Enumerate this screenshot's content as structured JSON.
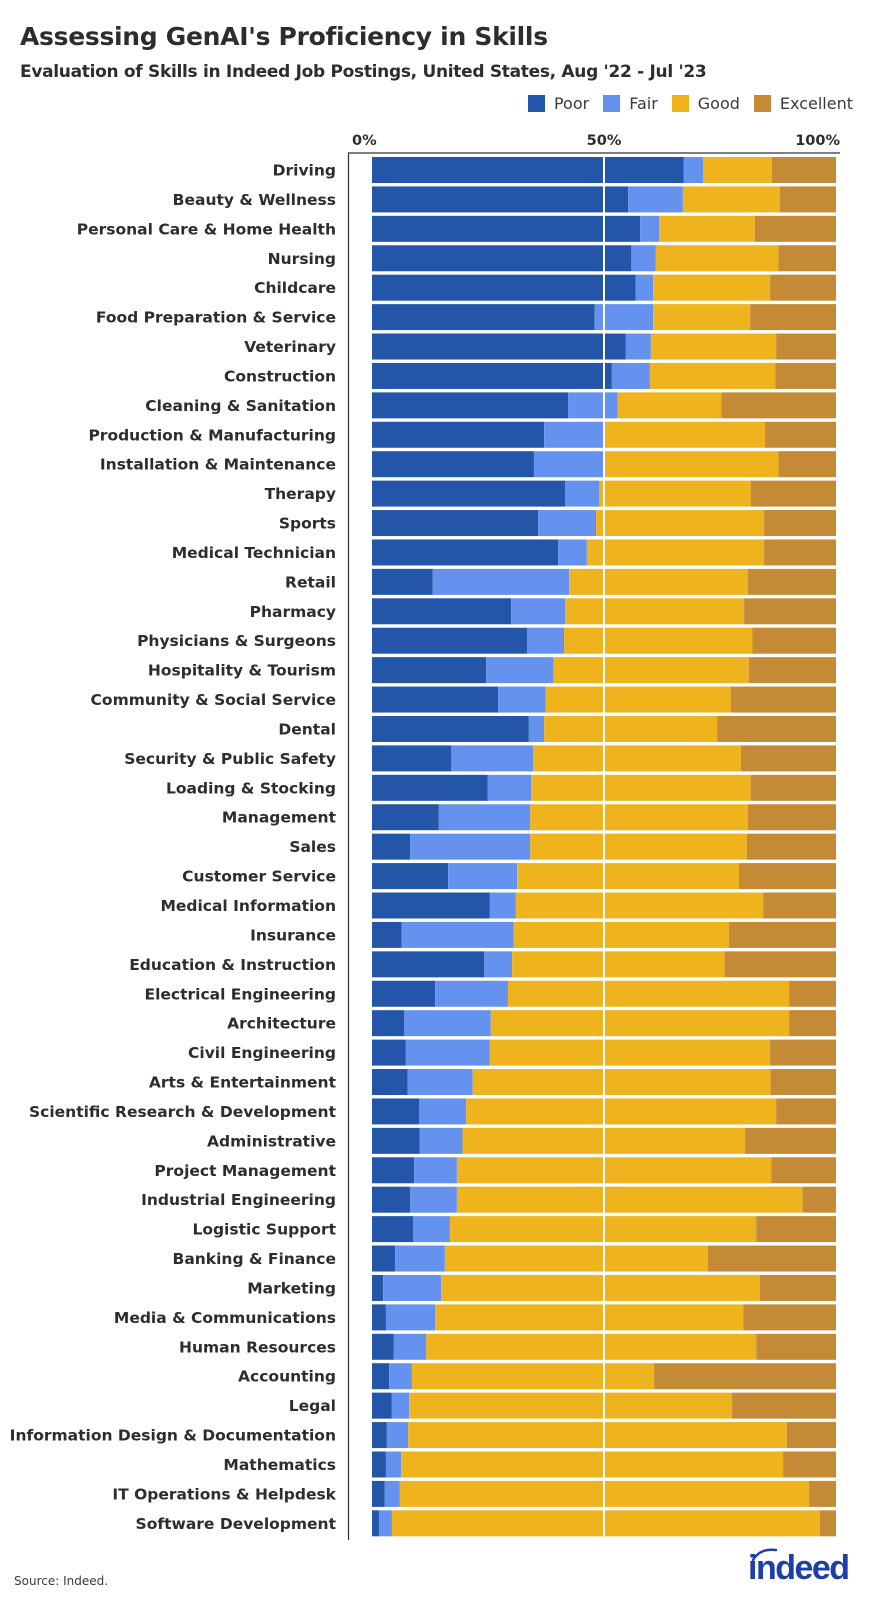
{
  "header": {
    "title": "Assessing GenAI's Proficiency in Skills",
    "subtitle": "Evaluation of Skills in Indeed Job Postings, United States, Aug '22 - Jul '23"
  },
  "footer": {
    "source": "Source: Indeed.",
    "logo_text": "indeed"
  },
  "chart_data": {
    "type": "bar",
    "orientation": "horizontal",
    "stacked": true,
    "normalized": true,
    "title": "Assessing GenAI's Proficiency in Skills",
    "subtitle": "Evaluation of Skills in Indeed Job Postings, United States, Aug '22 - Jul '23",
    "xlabel": "",
    "ylabel": "",
    "xlim": [
      0,
      100
    ],
    "x_ticks": [
      "0%",
      "50%",
      "100%"
    ],
    "x_tick_values": [
      0,
      50,
      100
    ],
    "reference_line": 50,
    "legend_position": "top-right",
    "grid": false,
    "categories": [
      "Driving",
      "Beauty & Wellness",
      "Personal Care & Home Health",
      "Nursing",
      "Childcare",
      "Food Preparation & Service",
      "Veterinary",
      "Construction",
      "Cleaning & Sanitation",
      "Production & Manufacturing",
      "Installation & Maintenance",
      "Therapy",
      "Sports",
      "Medical Technician",
      "Retail",
      "Pharmacy",
      "Physicians & Surgeons",
      "Hospitality & Tourism",
      "Community & Social Service",
      "Dental",
      "Security & Public Safety",
      "Loading & Stocking",
      "Management",
      "Sales",
      "Customer Service",
      "Medical Information",
      "Insurance",
      "Education & Instruction",
      "Electrical Engineering",
      "Architecture",
      "Civil Engineering",
      "Arts & Entertainment",
      "Scientific Research & Development",
      "Administrative",
      "Project Management",
      "Industrial Engineering",
      "Logistic Support",
      "Banking & Finance",
      "Marketing",
      "Media & Communications",
      "Human Resources",
      "Accounting",
      "Legal",
      "Information Design & Documentation",
      "Mathematics",
      "IT Operations & Helpdesk",
      "Software Development"
    ],
    "series": [
      {
        "name": "Poor",
        "color": "#2356a8",
        "values": [
          67.2,
          55.2,
          57.8,
          55.9,
          56.8,
          48.0,
          54.7,
          51.7,
          42.3,
          37.1,
          34.9,
          41.6,
          35.8,
          40.1,
          13.1,
          30.0,
          33.4,
          24.6,
          27.2,
          33.8,
          17.1,
          24.9,
          14.4,
          8.2,
          16.4,
          25.4,
          6.4,
          24.2,
          13.6,
          6.9,
          7.3,
          7.7,
          10.2,
          10.3,
          9.1,
          8.2,
          8.9,
          5.0,
          2.4,
          3.0,
          4.7,
          3.7,
          4.2,
          3.2,
          3.0,
          2.7,
          1.5
        ]
      },
      {
        "name": "Fair",
        "color": "#6592ee",
        "values": [
          4.2,
          11.8,
          4.1,
          5.2,
          3.8,
          12.6,
          5.4,
          8.2,
          10.6,
          12.8,
          15.0,
          7.4,
          12.5,
          6.2,
          29.4,
          11.6,
          8.0,
          14.5,
          10.2,
          3.3,
          17.6,
          9.4,
          19.7,
          25.9,
          14.9,
          5.6,
          24.1,
          6.0,
          15.7,
          18.7,
          18.1,
          14.0,
          10.1,
          9.2,
          9.2,
          10.1,
          7.9,
          10.7,
          12.5,
          10.6,
          7.0,
          4.9,
          3.8,
          4.6,
          3.3,
          3.3,
          2.8
        ]
      },
      {
        "name": "Good",
        "color": "#efb31d",
        "values": [
          14.8,
          20.9,
          20.6,
          26.5,
          25.2,
          20.9,
          27.0,
          27.0,
          22.4,
          34.8,
          37.7,
          32.6,
          36.2,
          38.2,
          38.5,
          38.6,
          40.6,
          42.1,
          39.9,
          37.3,
          44.8,
          47.3,
          46.9,
          46.7,
          47.8,
          53.3,
          46.4,
          45.8,
          60.6,
          64.3,
          60.4,
          64.2,
          66.8,
          60.9,
          67.8,
          74.5,
          66.0,
          56.7,
          68.7,
          66.4,
          71.1,
          52.2,
          69.6,
          81.6,
          82.3,
          88.2,
          92.2
        ]
      },
      {
        "name": "Excellent",
        "color": "#c48a36",
        "values": [
          13.8,
          12.1,
          17.5,
          12.4,
          14.2,
          18.5,
          12.9,
          13.1,
          24.7,
          15.3,
          12.4,
          18.4,
          15.5,
          15.5,
          19.0,
          19.8,
          18.0,
          18.8,
          22.7,
          25.6,
          20.5,
          18.4,
          19.0,
          19.2,
          20.9,
          15.7,
          23.1,
          24.0,
          10.1,
          10.1,
          14.2,
          14.1,
          12.9,
          19.6,
          13.9,
          7.2,
          17.2,
          27.6,
          16.4,
          20.0,
          17.2,
          39.2,
          22.4,
          10.6,
          11.4,
          5.8,
          3.5
        ]
      }
    ]
  }
}
